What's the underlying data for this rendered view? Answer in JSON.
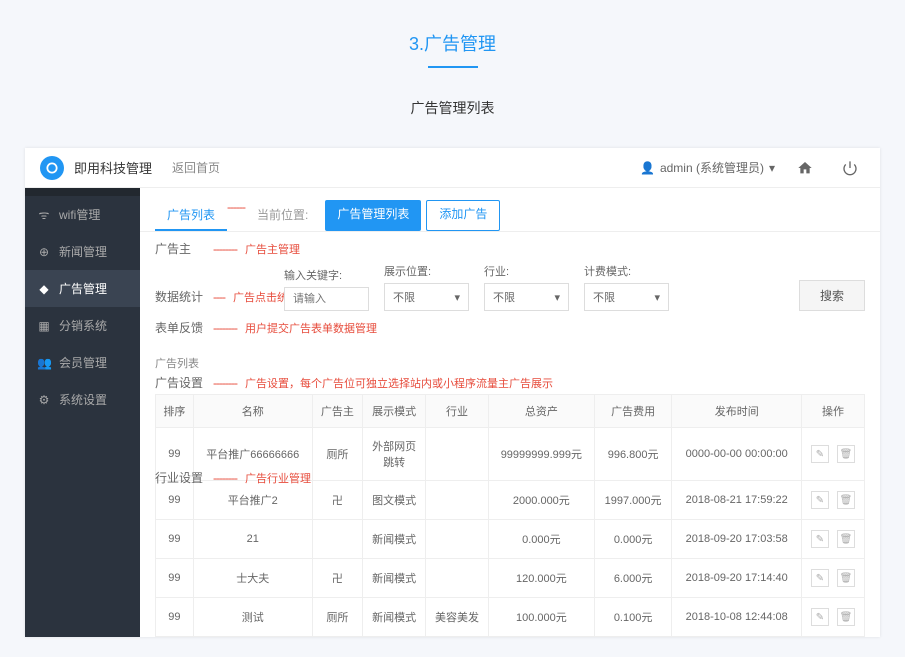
{
  "page": {
    "title": "3.广告管理",
    "subtitle": "广告管理列表"
  },
  "header": {
    "app_name": "即用科技管理",
    "back_link": "返回首页",
    "user": "admin (系统管理员)"
  },
  "sidebar": {
    "items": [
      {
        "icon": "📶",
        "label": "wifi管理"
      },
      {
        "icon": "⊕",
        "label": "新闻管理"
      },
      {
        "icon": "◈",
        "label": "广告管理"
      },
      {
        "icon": "▦",
        "label": "分销系统"
      },
      {
        "icon": "👥",
        "label": "会员管理"
      },
      {
        "icon": "⚙",
        "label": "系统设置"
      }
    ]
  },
  "tabs": {
    "list": "广告列表",
    "current": "当前位置:",
    "add": "添加广告"
  },
  "annotations": {
    "tab_list": "广告管理列表",
    "adv_owner": "广告主管理",
    "stats": "广告点击统计",
    "form": "用户提交广告表单数据管理",
    "settings": "广告设置，每个广告位可独立选择站内或小程序流量主广告展示",
    "industry": "广告行业管理"
  },
  "sub_labels": {
    "adv_owner": "广告主",
    "stats": "数据统计",
    "form": "表单反馈",
    "settings": "广告设置",
    "industry": "行业设置"
  },
  "filters": {
    "keyword_label": "输入关键字:",
    "keyword_placeholder": "请输入",
    "display_label": "展示位置:",
    "industry_label": "行业:",
    "billing_label": "计费模式:",
    "option_all": "不限",
    "search_btn": "搜索"
  },
  "table": {
    "section_label": "广告列表",
    "headers": {
      "rank": "排序",
      "name": "名称",
      "owner": "广告主",
      "mode": "展示模式",
      "industry": "行业",
      "total_asset": "总资产",
      "cost": "广告费用",
      "publish_time": "发布时间",
      "action": "操作"
    },
    "rows": [
      {
        "rank": "99",
        "name": "平台推广66666666",
        "owner": "厕所",
        "mode": "外部网页\n跳转",
        "industry": "",
        "total_asset": "99999999.999元",
        "cost": "996.800元",
        "publish_time": "0000-00-00 00:00:00"
      },
      {
        "rank": "99",
        "name": "平台推广2",
        "owner": "卍",
        "mode": "图文模式",
        "industry": "",
        "total_asset": "2000.000元",
        "cost": "1997.000元",
        "publish_time": "2018-08-21 17:59:22"
      },
      {
        "rank": "99",
        "name": "21",
        "owner": "",
        "mode": "新闻模式",
        "industry": "",
        "total_asset": "0.000元",
        "cost": "0.000元",
        "publish_time": "2018-09-20 17:03:58"
      },
      {
        "rank": "99",
        "name": "士大夫",
        "owner": "卍",
        "mode": "新闻模式",
        "industry": "",
        "total_asset": "120.000元",
        "cost": "6.000元",
        "publish_time": "2018-09-20 17:14:40"
      },
      {
        "rank": "99",
        "name": "测试",
        "owner": "厕所",
        "mode": "新闻模式",
        "industry": "美容美发",
        "total_asset": "100.000元",
        "cost": "0.100元",
        "publish_time": "2018-10-08 12:44:08"
      }
    ]
  }
}
